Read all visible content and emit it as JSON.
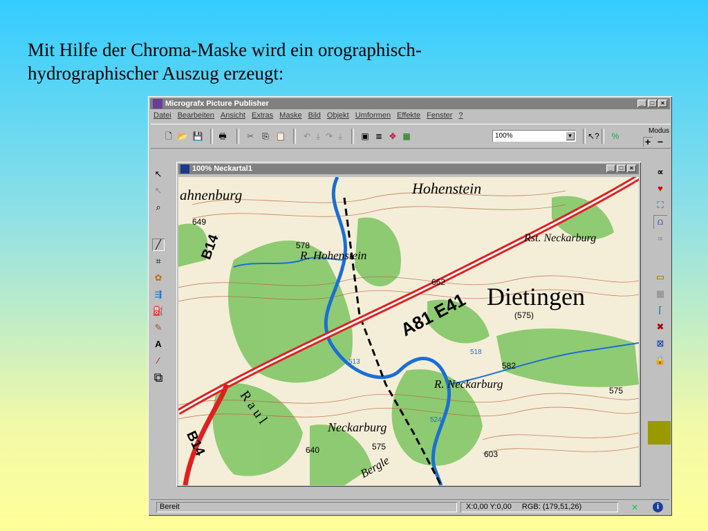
{
  "heading": {
    "line1": "Mit Hilfe der Chroma-Maske wird ein orographisch-",
    "line2": "hydrographischer Auszug erzeugt:"
  },
  "app": {
    "title": "Micrografx Picture Publisher",
    "window_controls": [
      "_",
      "□",
      "×"
    ],
    "menu": [
      "Datei",
      "Bearbeiten",
      "Ansicht",
      "Extras",
      "Maske",
      "Bild",
      "Objekt",
      "Umformen",
      "Effekte",
      "Fenster",
      "?"
    ],
    "zoom_value": "100%",
    "modus_label": "Modus",
    "modus_plus": "+",
    "modus_minus": "−"
  },
  "document": {
    "title": "100% Neckartal1",
    "window_controls": [
      "_",
      "□",
      "×"
    ]
  },
  "map_labels": {
    "hohenstein": "Hohenstein",
    "ahnenburg": "ahnenburg",
    "b14_top": "B14",
    "b14_bottom": "B14",
    "a81": "A81 E41",
    "dietingen": "Dietingen",
    "dietingen_elev": "(575)",
    "neckarburg_rst": "Rst. Neckarburg",
    "ruine_hohenstein": "R. Hohenstein",
    "ruine_neckarburg": "R. Neckarburg",
    "neckarburg": "Neckarburg",
    "elev_649": "649",
    "elev_578": "578",
    "elev_662": "662",
    "elev_640": "640",
    "elev_575a": "575",
    "elev_575b": "575",
    "elev_603": "603",
    "elev_582": "582",
    "elev_518": "518",
    "elev_513": "513",
    "elev_524": "524",
    "rauhe": "R a u l",
    "bergle": "Bergle"
  },
  "status": {
    "ready": "Bereit",
    "coords": "X:0,00  Y:0,00",
    "rgb": "RGB: (179,51,26)"
  },
  "colors": {
    "road": "#e02020",
    "river": "#1a6fd6",
    "forest": "#7cc460",
    "contour": "#b8603a",
    "titlebar": "#808080"
  }
}
